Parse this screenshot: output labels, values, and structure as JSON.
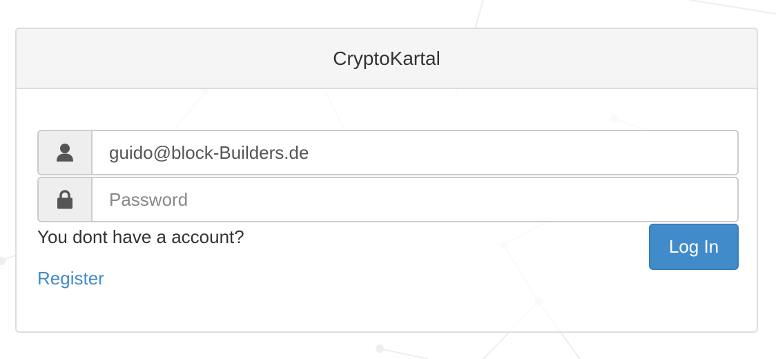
{
  "panel": {
    "title": "CryptoKartal"
  },
  "form": {
    "username": {
      "icon": "user-icon",
      "value": "guido@block-Builders.de",
      "placeholder": ""
    },
    "password": {
      "icon": "lock-icon",
      "value": "",
      "placeholder": "Password"
    },
    "no_account_text": "You dont have a account?",
    "register_label": "Register",
    "login_label": "Log In"
  },
  "colors": {
    "primary": "#428bca",
    "link": "#428bca",
    "heading_bg": "#f5f5f5",
    "addon_bg": "#eeeeee",
    "border": "#cccccc"
  }
}
